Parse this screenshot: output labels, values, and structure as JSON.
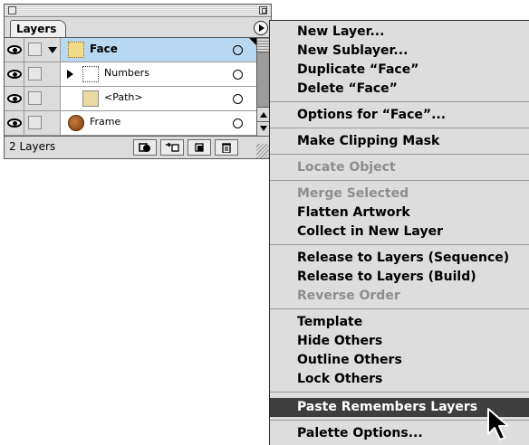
{
  "palette": {
    "tab": "Layers",
    "layer_count": "2 Layers",
    "rows": [
      {
        "name": "Face",
        "selected": true
      },
      {
        "name": "Numbers",
        "selected": false
      },
      {
        "name": "<Path>",
        "selected": false
      },
      {
        "name": "Frame",
        "selected": false
      }
    ],
    "icons": {
      "visibility": "eye-icon",
      "expand": "disclosure-triangle-icon",
      "target": "target-circle-icon",
      "menu": "palette-menu-icon"
    },
    "bottom_buttons": [
      "make-clipping-mask",
      "create-sublayer",
      "create-layer",
      "delete-selection"
    ]
  },
  "menu": {
    "items": [
      {
        "label": "New Layer...",
        "state": "normal"
      },
      {
        "label": "New Sublayer...",
        "state": "normal"
      },
      {
        "label": "Duplicate “Face”",
        "state": "normal"
      },
      {
        "label": "Delete “Face”",
        "state": "normal"
      },
      {
        "label": "Options for “Face”...",
        "state": "normal"
      },
      {
        "label": "Make Clipping Mask",
        "state": "normal"
      },
      {
        "label": "Locate Object",
        "state": "disabled"
      },
      {
        "label": "Merge Selected",
        "state": "disabled"
      },
      {
        "label": "Flatten Artwork",
        "state": "normal"
      },
      {
        "label": "Collect in New Layer",
        "state": "normal"
      },
      {
        "label": "Release to Layers (Sequence)",
        "state": "normal"
      },
      {
        "label": "Release to Layers (Build)",
        "state": "normal"
      },
      {
        "label": "Reverse Order",
        "state": "disabled"
      },
      {
        "label": "Template",
        "state": "normal"
      },
      {
        "label": "Hide Others",
        "state": "normal"
      },
      {
        "label": "Outline Others",
        "state": "normal"
      },
      {
        "label": "Lock Others",
        "state": "normal"
      },
      {
        "label": "Paste Remembers Layers",
        "state": "highlighted"
      },
      {
        "label": "Palette Options...",
        "state": "normal"
      }
    ]
  },
  "colors": {
    "selected_row": "#b8d7f0",
    "menu_bg": "#dddddd",
    "menu_highlight": "#3e3e3e",
    "disabled_text": "#8e8e8e"
  }
}
